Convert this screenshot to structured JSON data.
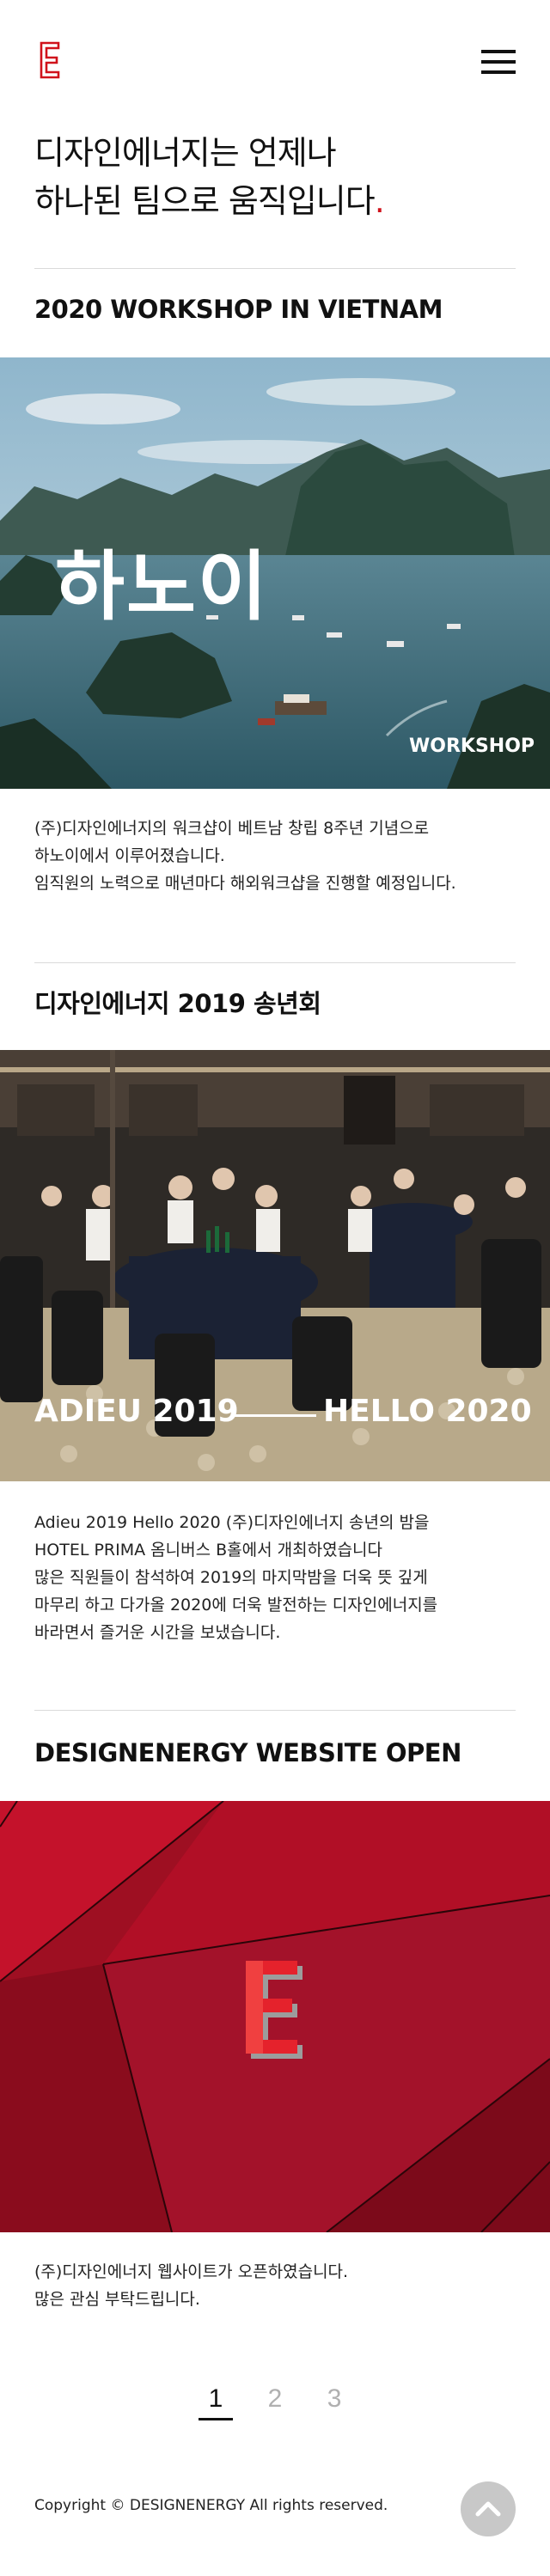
{
  "header": {
    "logo_letter": "E",
    "menu_icon": "hamburger-icon"
  },
  "hero": {
    "line1": "디자인에너지는 언제나",
    "line2": "하나된 팀으로 움직입니다",
    "dot": "."
  },
  "posts": [
    {
      "title": "2020 WORKSHOP IN VIETNAM",
      "image_caption_main": "하노이",
      "image_caption_sub": "WORKSHOP",
      "desc": [
        "(주)디자인에너지의 워크샵이 베트남 창립 8주년 기념으로",
        "하노이에서 이루어졌습니다.",
        "임직원의 노력으로 매년마다 해외워크샵을 진행할 예정입니다."
      ]
    },
    {
      "title": "디자인에너지 2019 송년회",
      "image_caption_left": "ADIEU 2019",
      "image_caption_right": "HELLO 2020",
      "desc": [
        "Adieu 2019 Hello 2020 (주)디자인에너지 송년의 밤을",
        "HOTEL PRIMA 옴니버스 B홀에서 개최하였습니다",
        "많은 직원들이 참석하여 2019의 마지막밤을 더욱 뜻 깊게",
        "마무리 하고 다가올 2020에 더욱 발전하는 디자인에너지를",
        "바라면서 즐거운 시간을 보냈습니다."
      ]
    },
    {
      "title": "DESIGNENERGY WEBSITE OPEN",
      "image_letter": "E",
      "desc": [
        "(주)디자인에너지 웹사이트가 오픈하였습니다.",
        "많은 관심 부탁드립니다."
      ]
    }
  ],
  "pagination": {
    "pages": [
      "1",
      "2",
      "3"
    ],
    "current": "1"
  },
  "footer": {
    "copyright": "Copyright © DESIGNENERGY All rights reserved.",
    "top_icon": "chevron-up-icon"
  },
  "colors": {
    "accent": "#d0121b",
    "text": "#111111",
    "divider": "#dadada",
    "top_button": "#c8c8c8"
  }
}
